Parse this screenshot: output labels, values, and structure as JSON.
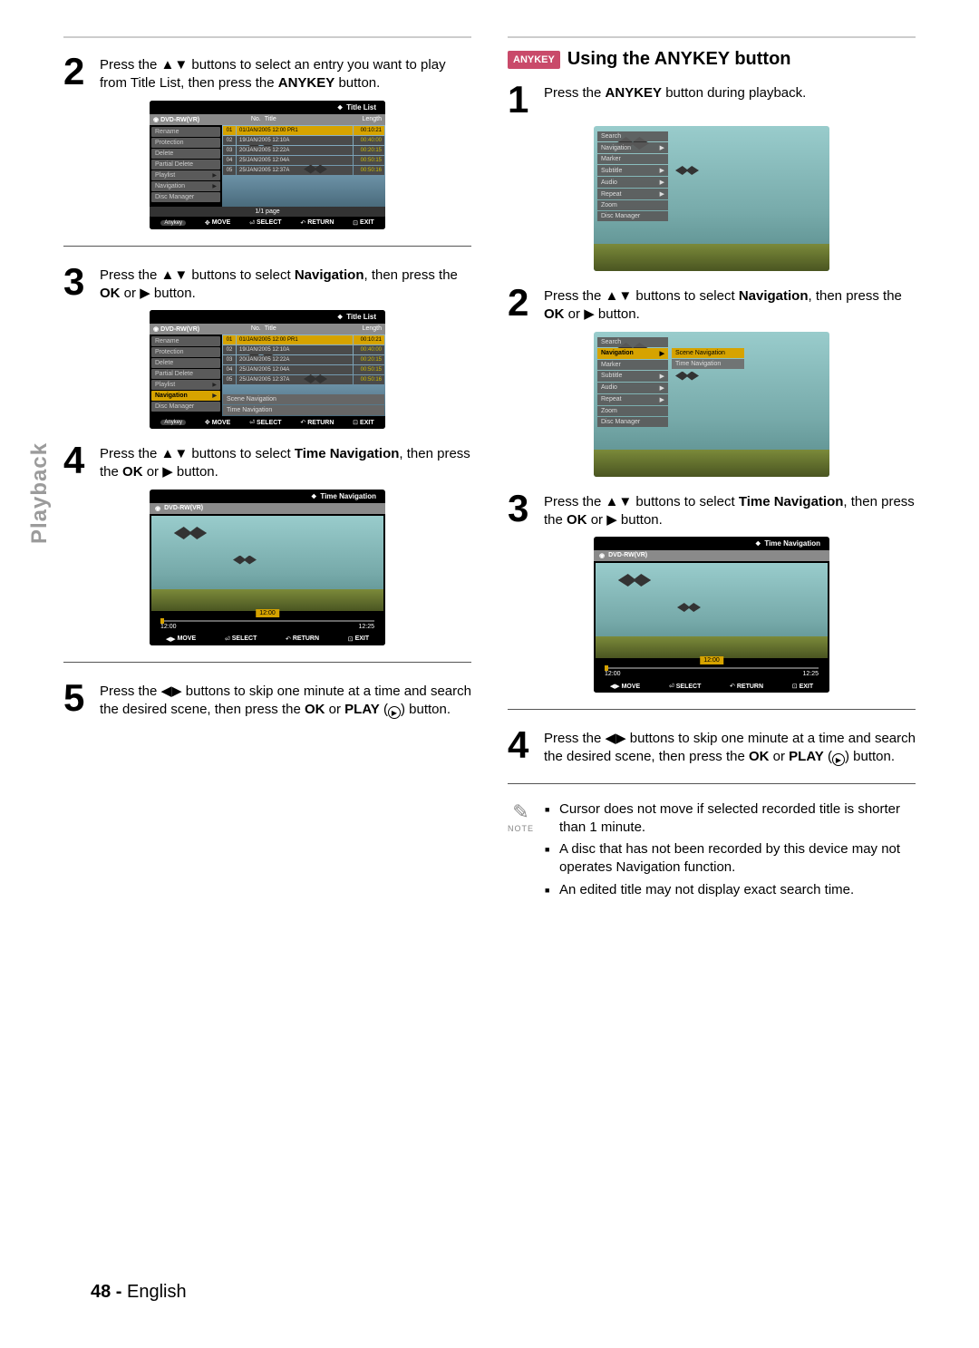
{
  "side_label": "Playback",
  "page_number": "48 -",
  "page_lang": "English",
  "left": {
    "step2": {
      "num": "2",
      "text_a": "Press the ",
      "glyph_ud": "▲▼",
      "text_b": " buttons to select an entry you want to play from Title List, then press the ",
      "anykey": "ANYKEY",
      "text_c": " button."
    },
    "step3": {
      "num": "3",
      "text_a": "Press the ",
      "glyph_ud": "▲▼",
      "text_b": " buttons to select ",
      "bold1": "Navigation",
      "text_c": ", then press the ",
      "bold2": "OK",
      "text_d": " or ",
      "glyph_r": "▶",
      "text_e": " button."
    },
    "step4": {
      "num": "4",
      "text_a": "Press the ",
      "glyph_ud": "▲▼",
      "text_b": " buttons to select ",
      "bold1": "Time Navigation",
      "text_c": ", then press the ",
      "bold2": "OK",
      "text_d": " or ",
      "glyph_r": "▶",
      "text_e": " button."
    },
    "step5": {
      "num": "5",
      "text_a": "Press the ",
      "glyph_lr": "◀▶",
      "text_b": " buttons to skip one minute at a time and search the desired scene, then press the ",
      "bold1": "OK",
      "text_c": " or ",
      "bold2": "PLAY",
      "text_d": " (",
      "circ": "▶",
      "text_e": ") button."
    }
  },
  "right": {
    "tag": "ANYKEY",
    "title": "Using the ANYKEY button",
    "step1": {
      "num": "1",
      "text_a": "Press the ",
      "bold1": "ANYKEY",
      "text_b": " button during playback."
    },
    "step2": {
      "num": "2",
      "text_a": "Press the ",
      "glyph_ud": "▲▼",
      "text_b": " buttons to select ",
      "bold1": "Navigation",
      "text_c": ", then press the ",
      "bold2": "OK",
      "text_d": " or ",
      "glyph_r": "▶",
      "text_e": " button."
    },
    "step3": {
      "num": "3",
      "text_a": "Press the ",
      "glyph_ud": "▲▼",
      "text_b": " buttons to select ",
      "bold1": "Time Navigation",
      "text_c": ", then press the ",
      "bold2": "OK",
      "text_d": " or ",
      "glyph_r": "▶",
      "text_e": " button."
    },
    "step4": {
      "num": "4",
      "text_a": "Press the ",
      "glyph_lr": "◀▶",
      "text_b": " buttons to skip one minute at a time and search the desired scene, then press the ",
      "bold1": "OK",
      "text_c": " or ",
      "bold2": "PLAY",
      "text_d": " (",
      "circ": "▶",
      "text_e": ") button."
    },
    "note_label": "NOTE",
    "notes": {
      "n0": "Cursor does not move if selected recorded title is shorter than 1 minute.",
      "n1": "A disc that has not been recorded by this device may not operates Navigation function.",
      "n2": "An edited title may not display exact search time."
    }
  },
  "osd": {
    "title_list": "Title List",
    "disc": "DVD-RW(VR)",
    "cols": {
      "no": "No.",
      "title": "Title",
      "len": "Length"
    },
    "menu": {
      "rename": "Rename",
      "protection": "Protection",
      "delete": "Delete",
      "partial": "Partial Delete",
      "playlist": "Playlist",
      "navigation": "Navigation",
      "discmgr": "Disc Manager"
    },
    "rows": {
      "r1": {
        "n": "01",
        "t": "01/JAN/2005 12:00 PR1",
        "l": "00:10:21"
      },
      "r2": {
        "n": "02",
        "t": "19/JAN/2005 12:10A",
        "l": "00:40:00"
      },
      "r3": {
        "n": "03",
        "t": "20/JAN/2005 12:22A",
        "l": "00:20:15"
      },
      "r4": {
        "n": "04",
        "t": "25/JAN/2005 12:04A",
        "l": "00:50:15"
      },
      "r5": {
        "n": "05",
        "t": "25/JAN/2005 12:37A",
        "l": "00:50:16"
      }
    },
    "page": "1/1 page",
    "sublist": {
      "scene": "Scene Navigation",
      "time": "Time Navigation"
    },
    "foot": {
      "move": "MOVE",
      "select": "SELECT",
      "return": "RETURN",
      "exit": "EXIT",
      "anykey": "Anykey"
    },
    "anymenu": {
      "search": "Search",
      "navigation": "Navigation",
      "marker": "Marker",
      "subtitle": "Subtitle",
      "audio": "Audio",
      "repeat": "Repeat",
      "zoom": "Zoom",
      "discmgr": "Disc Manager"
    },
    "timenav": {
      "title": "Time Navigation",
      "start": "12:00",
      "end": "12:25",
      "cur": "12:00"
    }
  }
}
